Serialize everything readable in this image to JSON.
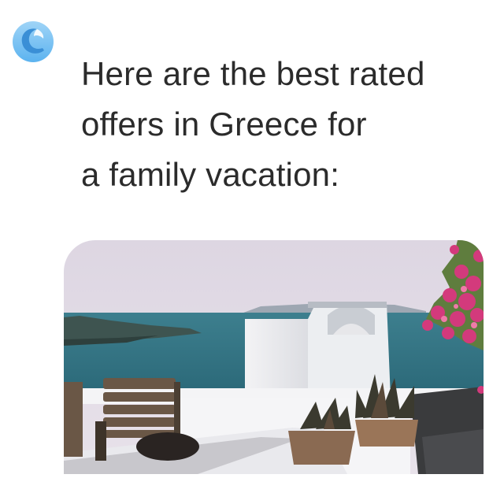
{
  "assistant": {
    "avatar_icon": "wave-logo-icon",
    "accent_color": "#3a9ee8"
  },
  "message": {
    "lines": [
      "Here are the best rated",
      "offers in Greece for",
      "a family vacation:"
    ],
    "text_color": "#2b2b2b"
  },
  "offer_image": {
    "icon": "santorini-terrace-photo"
  }
}
